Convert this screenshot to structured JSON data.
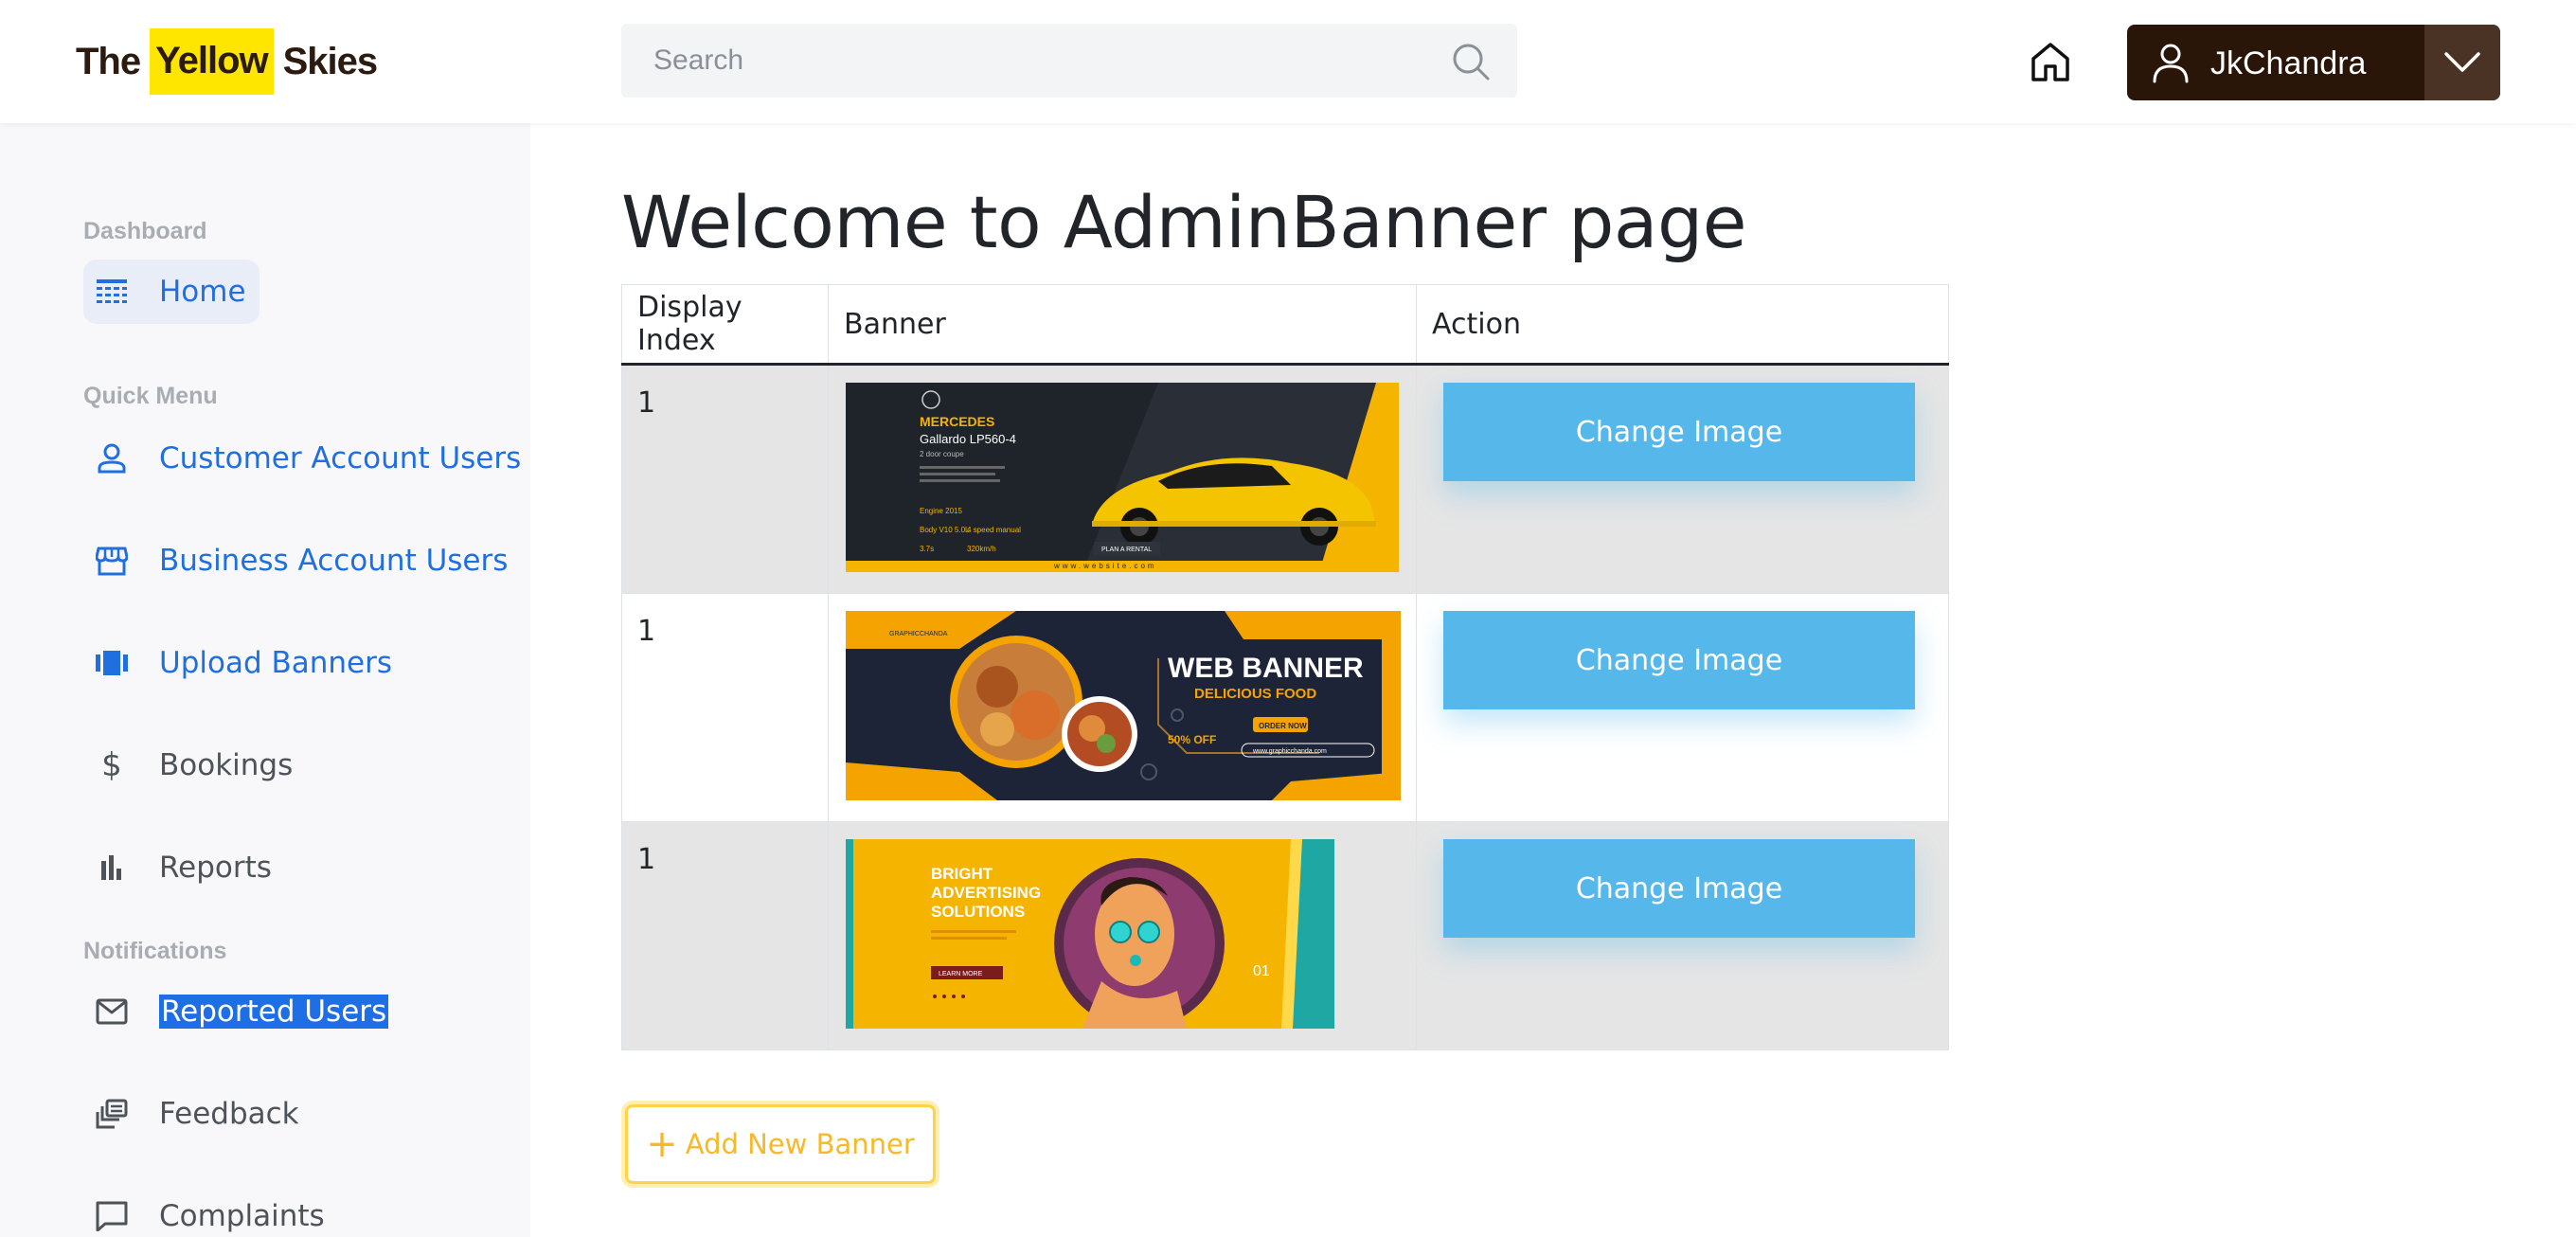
{
  "header": {
    "brand": {
      "part1": "The",
      "part2": "Yellow",
      "part3": "Skies"
    },
    "search_placeholder": "Search",
    "user_name": "JkChandra"
  },
  "sidebar": {
    "sections": [
      {
        "label": "Dashboard"
      },
      {
        "label": "Quick Menu"
      },
      {
        "label": "Notifications"
      }
    ],
    "items": [
      {
        "label": "Home",
        "icon": "dashboard-icon"
      },
      {
        "label": "Customer Account Users",
        "icon": "person-icon"
      },
      {
        "label": "Business Account Users",
        "icon": "store-icon"
      },
      {
        "label": "Upload Banners",
        "icon": "slides-icon"
      },
      {
        "label": "Bookings",
        "icon": "dollar-icon"
      },
      {
        "label": "Reports",
        "icon": "bar-chart-icon"
      },
      {
        "label": "Reported Users",
        "icon": "mail-icon"
      },
      {
        "label": "Feedback",
        "icon": "feedback-icon"
      },
      {
        "label": "Complaints",
        "icon": "chat-bubble-icon"
      }
    ]
  },
  "main": {
    "title": "Welcome to AdminBanner page",
    "table": {
      "headers": [
        "Display Index",
        "Banner",
        "Action"
      ],
      "rows": [
        {
          "index": "1",
          "banner": {
            "brand": "MERCEDES",
            "model": "Gallardo LP560-4",
            "subtitle": "2 door coupe",
            "specs": [
              "Engine 2015",
              "Body V10 5.0L",
              "4 speed manual",
              "3.7s",
              "320km/h"
            ],
            "cta": "PLAN A RENTAL",
            "site": "www.website.com"
          },
          "action": "Change Image"
        },
        {
          "index": "1",
          "banner": {
            "title": "WEB BANNER",
            "subtitle": "DELICIOUS FOOD",
            "cta": "ORDER NOW",
            "discount": "50% OFF",
            "logo": "GRAPHICCHANDA",
            "site": "www.graphicchanda.com"
          },
          "action": "Change Image"
        },
        {
          "index": "1",
          "banner": {
            "title_lines": [
              "BRIGHT",
              "ADVERTISING",
              "SOLUTIONS"
            ],
            "cta": "LEARN MORE",
            "page": "01"
          },
          "action": "Change Image"
        }
      ]
    },
    "add_button": "Add New Banner"
  },
  "colors": {
    "brand_dark": "#2a1509",
    "brand_yellow": "#ffe600",
    "accent_blue": "#1f6fe0",
    "button_blue": "#56b8ea",
    "add_yellow": "#f7b928"
  }
}
